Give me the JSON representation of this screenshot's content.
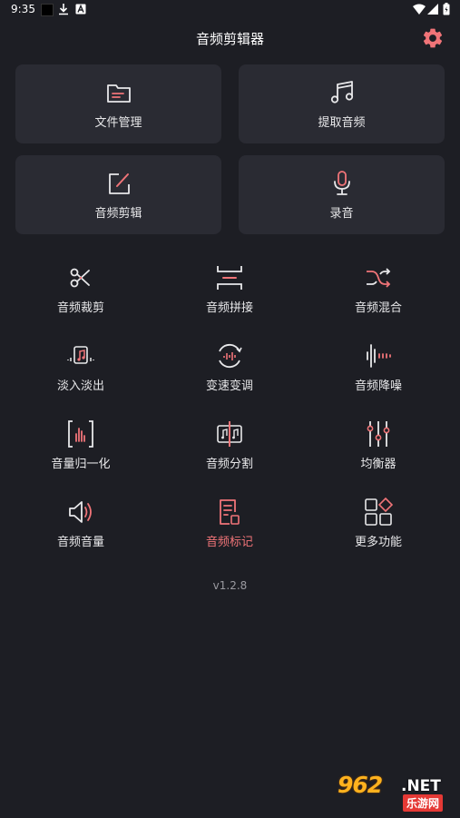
{
  "status_bar": {
    "time": "9:35",
    "icons": [
      "notification-square-icon",
      "download-icon",
      "a-box-icon",
      "wifi-icon",
      "signal-icon",
      "battery-icon"
    ]
  },
  "header": {
    "title": "音频剪辑器",
    "settings_icon": "gear-icon"
  },
  "cards": [
    {
      "label": "文件管理",
      "icon": "folder-icon"
    },
    {
      "label": "提取音频",
      "icon": "music-note-icon"
    },
    {
      "label": "音频剪辑",
      "icon": "edit-icon"
    },
    {
      "label": "录音",
      "icon": "microphone-icon"
    }
  ],
  "tools": [
    {
      "label": "音频裁剪",
      "icon": "scissors-icon"
    },
    {
      "label": "音频拼接",
      "icon": "splice-icon"
    },
    {
      "label": "音频混合",
      "icon": "shuffle-icon"
    },
    {
      "label": "淡入淡出",
      "icon": "fade-icon"
    },
    {
      "label": "变速变调",
      "icon": "speed-pitch-icon"
    },
    {
      "label": "音频降噪",
      "icon": "denoise-icon"
    },
    {
      "label": "音量归一化",
      "icon": "normalize-icon"
    },
    {
      "label": "音频分割",
      "icon": "split-icon"
    },
    {
      "label": "均衡器",
      "icon": "equalizer-icon"
    },
    {
      "label": "音频音量",
      "icon": "volume-icon"
    },
    {
      "label": "音频标记",
      "icon": "mark-icon"
    },
    {
      "label": "更多功能",
      "icon": "more-grid-icon"
    }
  ],
  "version": "v1.2.8",
  "watermark": {
    "main": "962",
    "net": ".NET",
    "sub": "乐游网"
  },
  "colors": {
    "background": "#1d1e24",
    "card": "#2a2b33",
    "accent": "#f07478",
    "text": "#e8e8ea",
    "muted": "#9a9aa0"
  }
}
